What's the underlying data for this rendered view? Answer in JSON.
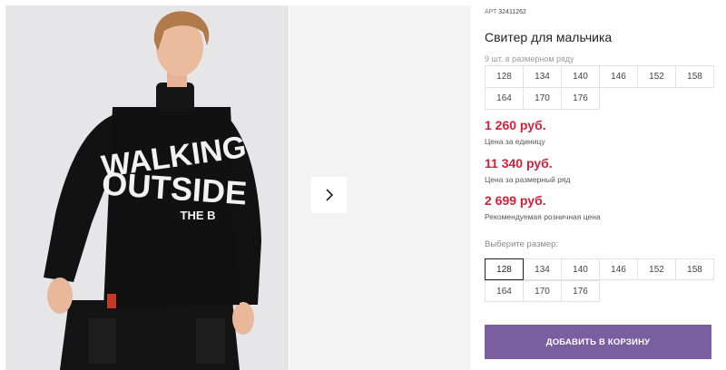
{
  "product": {
    "sku_label": "АРТ",
    "sku_value": "32411262",
    "title": "Свитер для мальчика",
    "pack_note": "9 шт. в размерном ряду"
  },
  "size_range": [
    "128",
    "134",
    "140",
    "146",
    "152",
    "158",
    "164",
    "170",
    "176"
  ],
  "prices": [
    {
      "value": "1 260 руб.",
      "label": "Цена за единицу"
    },
    {
      "value": "11 340 руб.",
      "label": "Цена за размерный ряд"
    },
    {
      "value": "2 699 руб.",
      "label": "Рекомендуемая розничная цена"
    }
  ],
  "size_select": {
    "label": "Выберите размер:",
    "options": [
      "128",
      "134",
      "140",
      "146",
      "152",
      "158",
      "164",
      "170",
      "176"
    ],
    "selected": "128"
  },
  "cart_button": "ДОБАВИТЬ В КОРЗИНУ",
  "gallery": {
    "print_line1": "WALKING",
    "print_line2": "OUTSIDE",
    "print_line3": "THE B"
  },
  "colors": {
    "accent": "#7a5fa0",
    "price": "#d3203a"
  },
  "icons": {
    "next": "chevron-right-icon"
  }
}
